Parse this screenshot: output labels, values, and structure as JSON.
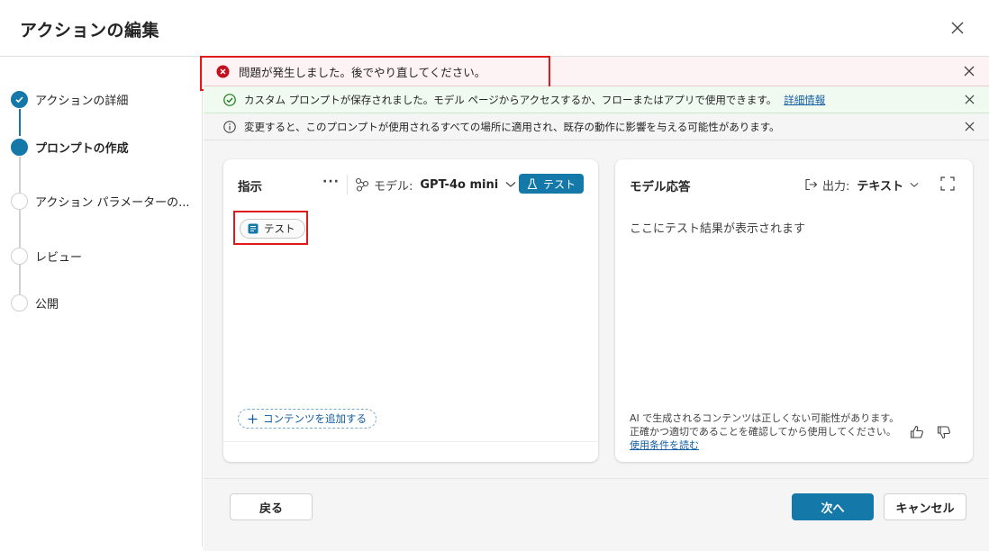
{
  "dialog": {
    "title": "アクションの編集"
  },
  "steps": [
    {
      "label": "アクションの詳細",
      "state": "done"
    },
    {
      "label": "プロンプトの作成",
      "state": "current"
    },
    {
      "label": "アクション パラメーターの...",
      "state": "pending"
    },
    {
      "label": "レビュー",
      "state": "pending"
    },
    {
      "label": "公開",
      "state": "pending"
    }
  ],
  "banners": {
    "error": {
      "text": "問題が発生しました。後でやり直してください。"
    },
    "success": {
      "text": "カスタム プロンプトが保存されました。モデル ページからアクセスするか、フローまたはアプリで使用できます。",
      "link": "詳細情報"
    },
    "info": {
      "text": "変更すると、このプロンプトが使用されるすべての場所に適用され、既存の動作に影響を与える可能性があります。"
    }
  },
  "instructions": {
    "title": "指示",
    "more": "···",
    "model_label": "モデル:",
    "model_value": "GPT-4o mini",
    "test_button": "テスト",
    "chip_label": "テスト",
    "add_content": "コンテンツを追加する"
  },
  "response": {
    "title": "モデル応答",
    "output_label": "出力:",
    "output_value": "テキスト",
    "placeholder": "ここにテスト結果が表示されます",
    "disclaimer": "AI で生成されるコンテンツは正しくない可能性があります。正確かつ適切であることを確認してから使用してください。",
    "terms_link": "使用条件を読む"
  },
  "footer": {
    "back": "戻る",
    "next": "次へ",
    "cancel": "キャンセル"
  },
  "colors": {
    "accent": "#1479a8",
    "error": "#c50f1f",
    "success": "#107c10",
    "highlight": "#e01a1a"
  }
}
